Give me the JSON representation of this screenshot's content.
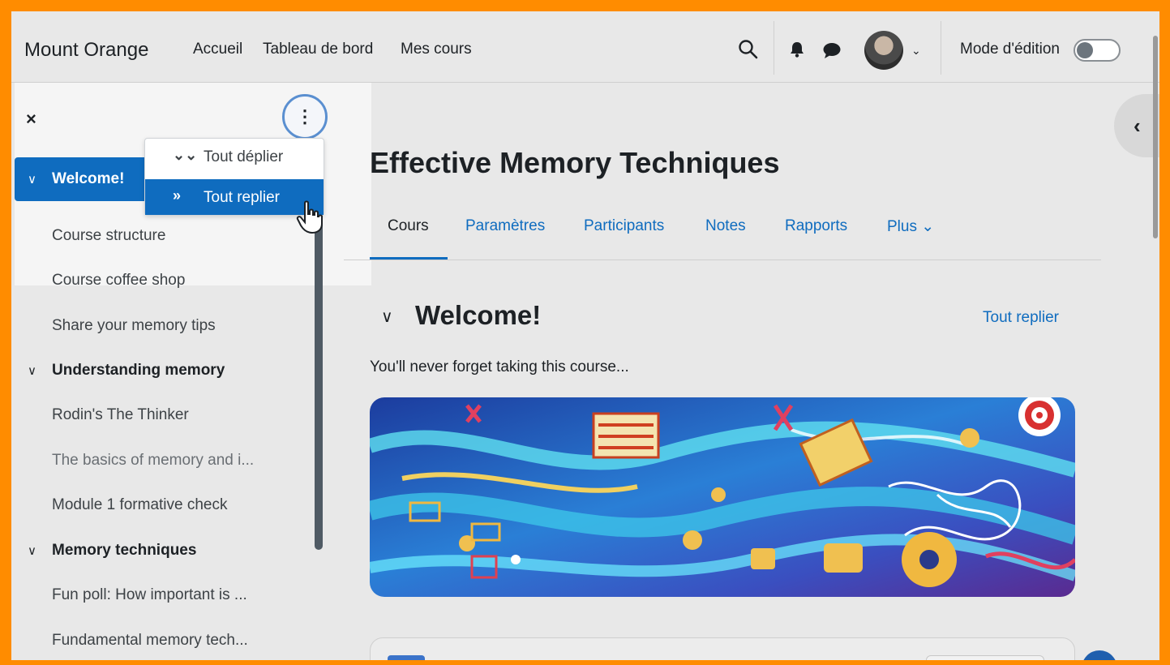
{
  "navbar": {
    "brand": "Mount Orange",
    "links": [
      "Accueil",
      "Tableau de bord",
      "Mes cours"
    ],
    "edit_mode_label": "Mode d'édition",
    "edit_mode_on": false,
    "icons": [
      "search-icon",
      "bell-icon",
      "chat-icon",
      "user-avatar",
      "chevron-down-icon"
    ]
  },
  "course_index": {
    "close_glyph": "×",
    "more_glyph": "⋮",
    "active_section": "Welcome!",
    "items": [
      {
        "label": "Course structure",
        "type": "activity"
      },
      {
        "label": "Course coffee shop",
        "type": "activity"
      },
      {
        "label": "Share your memory tips",
        "type": "activity"
      },
      {
        "label": "Understanding memory",
        "type": "section"
      },
      {
        "label": "Rodin's The Thinker",
        "type": "activity"
      },
      {
        "label": "The basics of memory and i...",
        "type": "activity",
        "muted": true
      },
      {
        "label": "Module 1 formative check",
        "type": "activity"
      },
      {
        "label": "Memory techniques",
        "type": "section"
      },
      {
        "label": "Fun poll: How important is ...",
        "type": "activity"
      },
      {
        "label": "Fundamental memory tech...",
        "type": "activity"
      }
    ]
  },
  "dropdown": {
    "expand_all": "Tout déplier",
    "collapse_all": "Tout replier",
    "highlighted": "Tout replier"
  },
  "course": {
    "title": "Effective Memory Techniques",
    "tabs": [
      "Cours",
      "Paramètres",
      "Participants",
      "Notes",
      "Rapports",
      "Plus ⌄"
    ],
    "active_tab": "Cours",
    "section_title": "Welcome!",
    "collapse_all_link": "Tout replier",
    "section_summary": "You'll never forget taking this course..."
  },
  "colors": {
    "accent": "#0f6cbf",
    "frame": "#ff8c00",
    "page_bg": "#e8e8e8"
  }
}
